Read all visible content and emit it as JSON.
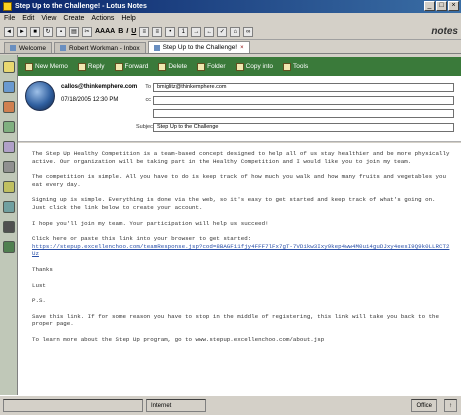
{
  "window": {
    "title": "Step Up to the Challenge! - Lotus Notes",
    "min": "_",
    "max": "□",
    "close": "×"
  },
  "menu": [
    "File",
    "Edit",
    "View",
    "Create",
    "Actions",
    "Help"
  ],
  "toolbar": {
    "font": "AAAA",
    "bold": "B",
    "italic": "I",
    "underline": "U",
    "brand": "notes"
  },
  "tabs": [
    {
      "label": "Welcome"
    },
    {
      "label": "Robert Workman - Inbox"
    },
    {
      "label": "Step Up to the Challenge!"
    }
  ],
  "actions": [
    "New Memo",
    "Reply",
    "Forward",
    "Delete",
    "Folder",
    "Copy into",
    "Tools"
  ],
  "header": {
    "sender": "callos@thinkemphere.com",
    "date": "07/18/2005 12:30 PM",
    "to_label": "To",
    "to_value": "bmiglitz@thinkemphere.com",
    "cc_label": "cc",
    "cc_value": "",
    "bcc_label": "",
    "bcc_value": "",
    "subject_label": "Subject",
    "subject_value": "Step Up to the Challenge"
  },
  "body": {
    "p1": "The Step Up Healthy Competition is a team-based concept designed to help all of us stay healthier and be more physically active. Our organization will be taking part in the Healthy Competition and I would like you to join my team.",
    "p2": "The competition is simple. All you have to do is keep track of how much you walk and how many fruits and vegetables you eat every day.",
    "p3": "Signing up is simple. Everything is done via the web, so it's easy to get started and keep track of what's going on. Just click the link below to create your account.",
    "p4": "I hope you'll join my team. Your participation will help us succeed!",
    "p5": "Click here or paste this link into your browser to get started:",
    "link": "https://stepup.excellenchoo.com/teamResponse.jsp?cod=8BAGF11fjy4FFF7lFx7gT-7VDikw3Ixy9kep4ww4M0ui4guDJxy4eesI9Q9k0LLRCT2Uz",
    "p6": "Thanks",
    "p7": "Lust",
    "p8": "P.S.",
    "p9": "Save this link. If for some reason you have to stop in the middle of registering, this link will take you back to the proper page.",
    "p10": "To learn more about the Step Up program, go to www.stepup.excellenchoo.com/about.jsp"
  },
  "status": {
    "left": "",
    "mid": "Internet",
    "right1": "Office",
    "right2": "↑"
  }
}
